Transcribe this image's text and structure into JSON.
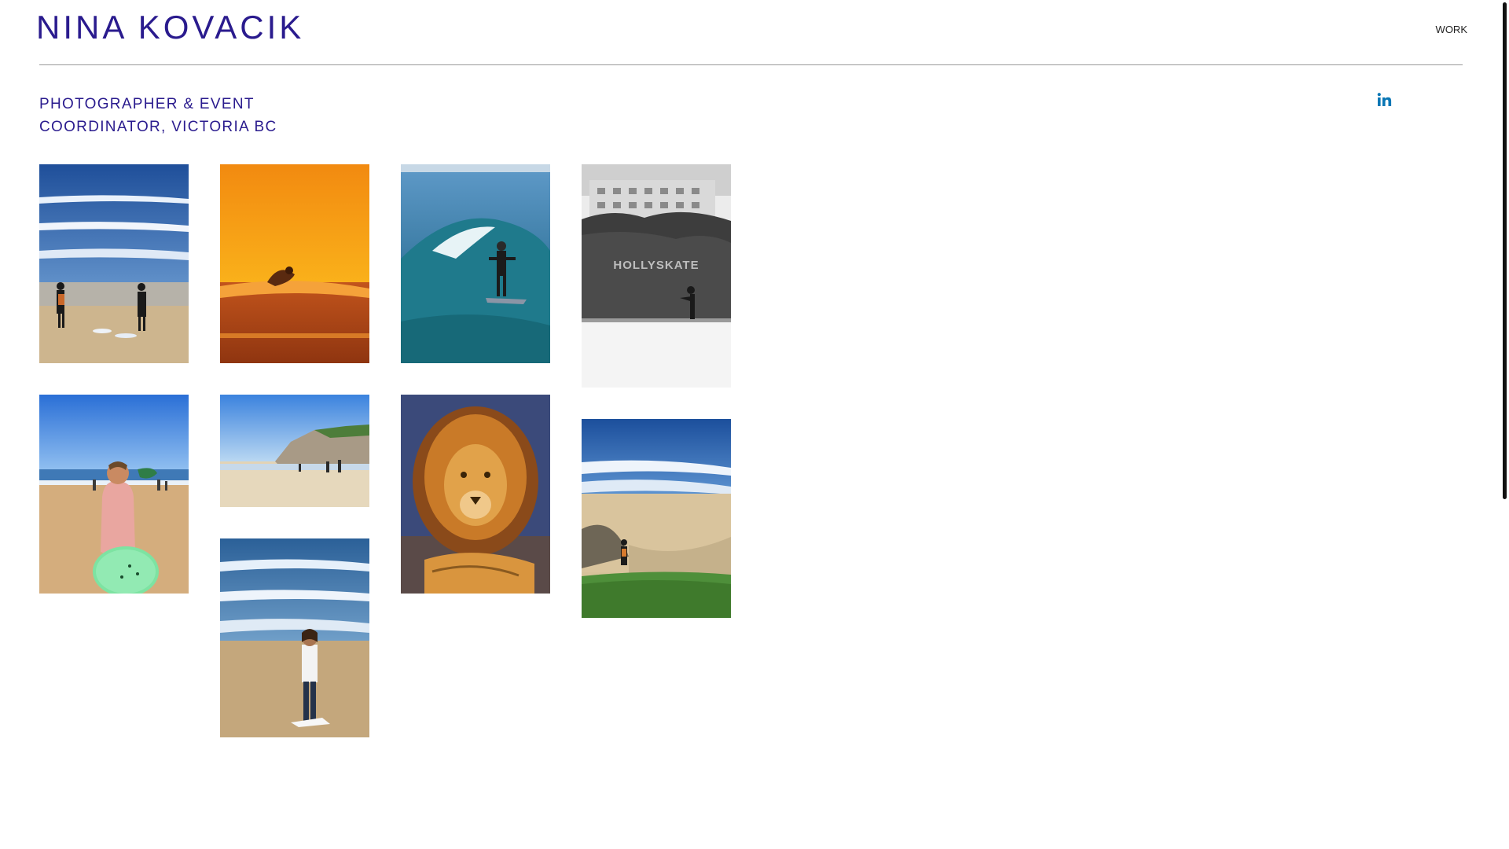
{
  "header": {
    "site_title": "NINA KOVACIK",
    "nav_work": "WORK"
  },
  "tagline": {
    "line1": "PHOTOGRAPHER & EVENT",
    "line2": "COORDINATOR, VICTORIA BC"
  },
  "social": {
    "linkedin_icon": "linkedin-icon",
    "linkedin_label": "in"
  },
  "gallery": {
    "items": [
      {
        "subject": "surfers on beach",
        "icon": "photo"
      },
      {
        "subject": "sunset surf silhouette",
        "icon": "photo"
      },
      {
        "subject": "surfer riding wave",
        "icon": "photo"
      },
      {
        "subject": "holly skate black and white",
        "icon": "photo"
      },
      {
        "subject": "surfer holding green board",
        "icon": "photo"
      },
      {
        "subject": "beach with cliffs",
        "icon": "photo"
      },
      {
        "subject": "lion",
        "icon": "photo"
      },
      {
        "subject": "surfer on shore with grass",
        "icon": "photo"
      },
      {
        "subject": "woman standing at shoreline",
        "icon": "photo"
      }
    ],
    "sign_text": "HOLLYSKATE"
  },
  "colors": {
    "brand": "#2a1b8e",
    "linkedin": "#0a77b5",
    "rule": "#9a9a9a",
    "scrollbar": "#111111"
  }
}
